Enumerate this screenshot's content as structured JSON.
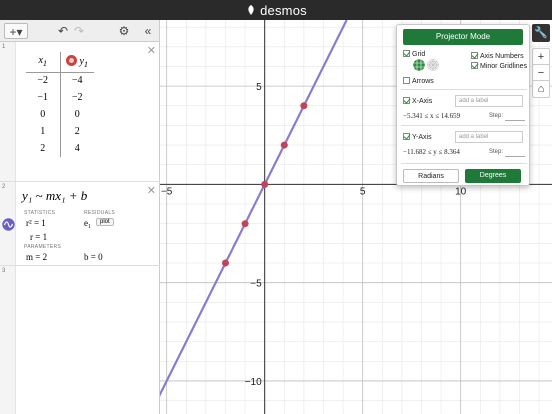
{
  "app": {
    "brand": "desmos"
  },
  "toolbar": {
    "add_label": "+▾",
    "undo_label": "↶",
    "redo_label": "↷",
    "settings_label": "⚙",
    "collapse_label": "«"
  },
  "expressions": {
    "table": {
      "index": "1",
      "header_x": "x",
      "header_x_sub": "1",
      "header_y": "y",
      "header_y_sub": "1",
      "rows": [
        [
          "−2",
          "−4"
        ],
        [
          "−1",
          "−2"
        ],
        [
          "0",
          "0"
        ],
        [
          "1",
          "2"
        ],
        [
          "2",
          "4"
        ]
      ]
    },
    "regression": {
      "index": "2",
      "formula": "y₁ ~ mx₁ + b",
      "statistics_label": "STATISTICS",
      "residuals_label": "RESIDUALS",
      "r2": "r² = 1",
      "r": "r = 1",
      "residual_var": "e₁",
      "plot_label": "plot",
      "parameters_label": "PARAMETERS",
      "m": "m = 2",
      "b": "b = 0"
    },
    "empty": {
      "index": "3"
    }
  },
  "graph_settings": {
    "projector_mode": "Projector Mode",
    "grid": "Grid",
    "arrows": "Arrows",
    "axis_numbers": "Axis Numbers",
    "minor_gridlines": "Minor Gridlines",
    "x_axis": "X-Axis",
    "y_axis": "Y-Axis",
    "add_label": "add a label",
    "x_range": "−5.341 ≤ x ≤ 14.659",
    "y_range": "−11.682 ≤ y ≤ 8.364",
    "step": "Step:",
    "radians": "Radians",
    "degrees": "Degrees"
  },
  "right_tools": {
    "wrench": "🔧",
    "zoom_in": "+",
    "zoom_out": "−",
    "home": "⌂"
  },
  "colors": {
    "line": "#8b7bd0",
    "points": "#c0445a",
    "button_green": "#1f7a3a",
    "header": "#2a2a2a"
  },
  "chart_data": {
    "type": "scatter",
    "xlim": [
      -5.341,
      14.659
    ],
    "ylim": [
      -11.682,
      8.364
    ],
    "x_ticks": [
      -5,
      5,
      10
    ],
    "y_ticks": [
      5,
      -5,
      -10
    ],
    "points": [
      {
        "x": -2,
        "y": -4
      },
      {
        "x": -1,
        "y": -2
      },
      {
        "x": 0,
        "y": 0
      },
      {
        "x": 1,
        "y": 2
      },
      {
        "x": 2,
        "y": 4
      }
    ],
    "regression": {
      "m": 2,
      "b": 0
    }
  }
}
